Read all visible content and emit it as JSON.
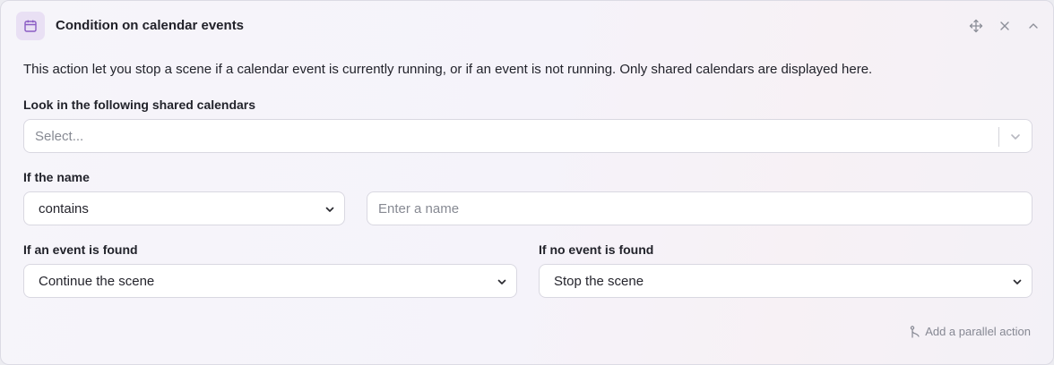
{
  "header": {
    "title": "Condition on calendar events",
    "icon": "calendar-icon"
  },
  "description": "This action let you stop a scene if a calendar event is currently running, or if an event is not running. Only shared calendars are displayed here.",
  "calendars": {
    "label": "Look in the following shared calendars",
    "placeholder": "Select..."
  },
  "name_filter": {
    "label": "If the name",
    "operator": "contains",
    "placeholder": "Enter a name"
  },
  "event_found": {
    "label": "If an event is found",
    "value": "Continue the scene"
  },
  "no_event_found": {
    "label": "If no event is found",
    "value": "Stop the scene"
  },
  "footer": {
    "parallel_label": "Add a parallel action"
  },
  "colors": {
    "accent": "#7b4fb8",
    "icon_bg": "#e9e0f4"
  }
}
